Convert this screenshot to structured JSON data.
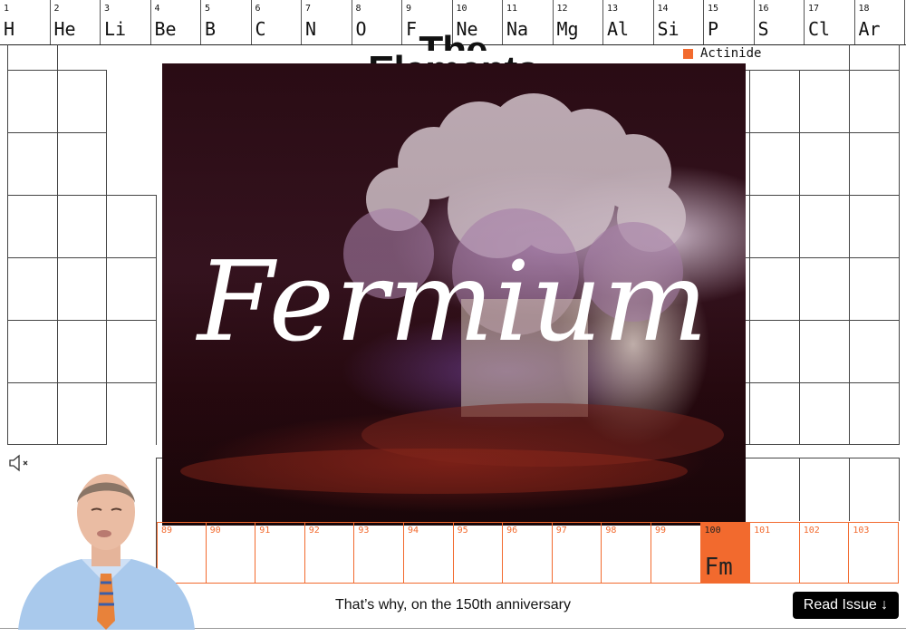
{
  "top_elements": [
    {
      "num": "1",
      "sym": "H"
    },
    {
      "num": "2",
      "sym": "He"
    },
    {
      "num": "3",
      "sym": "Li"
    },
    {
      "num": "4",
      "sym": "Be"
    },
    {
      "num": "5",
      "sym": "B"
    },
    {
      "num": "6",
      "sym": "C"
    },
    {
      "num": "7",
      "sym": "N"
    },
    {
      "num": "8",
      "sym": "O"
    },
    {
      "num": "9",
      "sym": "F"
    },
    {
      "num": "10",
      "sym": "Ne"
    },
    {
      "num": "11",
      "sym": "Na"
    },
    {
      "num": "12",
      "sym": "Mg"
    },
    {
      "num": "13",
      "sym": "Al"
    },
    {
      "num": "14",
      "sym": "Si"
    },
    {
      "num": "15",
      "sym": "P"
    },
    {
      "num": "16",
      "sym": "S"
    },
    {
      "num": "17",
      "sym": "Cl"
    },
    {
      "num": "18",
      "sym": "Ar"
    }
  ],
  "title": {
    "line1": "The",
    "line2": "Elements"
  },
  "legend": {
    "label": "Actinide",
    "color": "#f26a2e"
  },
  "headline": "Fermium",
  "actinides": [
    {
      "num": "89"
    },
    {
      "num": "90"
    },
    {
      "num": "91"
    },
    {
      "num": "92"
    },
    {
      "num": "93"
    },
    {
      "num": "94"
    },
    {
      "num": "95"
    },
    {
      "num": "96"
    },
    {
      "num": "97"
    },
    {
      "num": "98"
    },
    {
      "num": "99"
    },
    {
      "num": "100",
      "sym": "Fm",
      "active": true
    },
    {
      "num": "101"
    },
    {
      "num": "102"
    },
    {
      "num": "103"
    }
  ],
  "caption": "That’s why, on the 150th anniversary",
  "cta": {
    "label": "Read Issue ↓"
  },
  "icons": {
    "mute": "speaker-muted-icon"
  }
}
